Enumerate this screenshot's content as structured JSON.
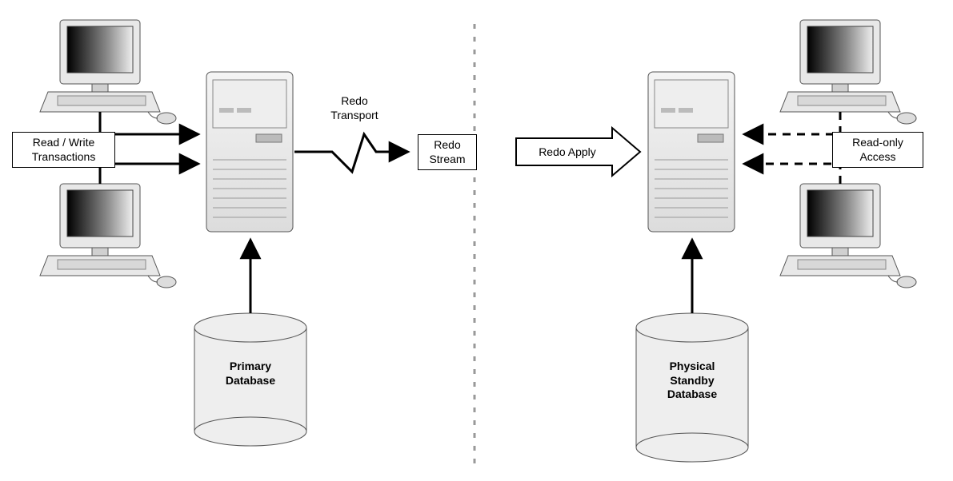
{
  "left": {
    "client_label": "Read / Write\nTransactions",
    "db_label": "Primary\nDatabase"
  },
  "center": {
    "redo_transport_label": "Redo\nTransport",
    "redo_stream_box": "Redo\nStream",
    "redo_apply_label": "Redo Apply"
  },
  "right": {
    "client_label": "Read-only\nAccess",
    "db_label": "Physical\nStandby\nDatabase"
  }
}
